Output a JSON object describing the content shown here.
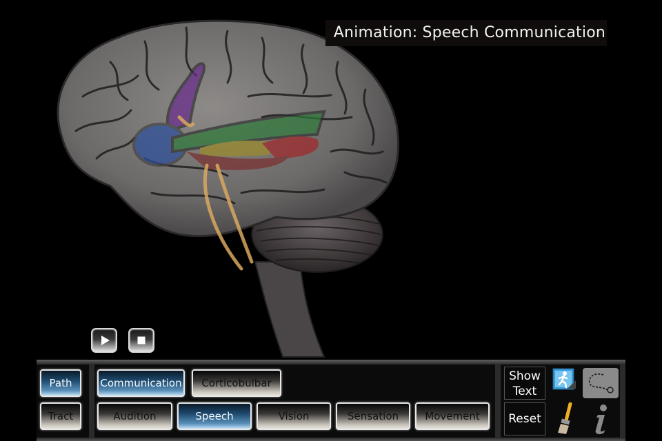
{
  "title": "Animation: Speech Communication",
  "media_controls": {
    "play_icon": "play-icon",
    "stop_icon": "stop-icon"
  },
  "brain_regions": [
    {
      "name": "purple-region",
      "color": "#6a2c8c"
    },
    {
      "name": "blue-region",
      "color": "#2c4f9a"
    },
    {
      "name": "green-region",
      "color": "#2f7a3a"
    },
    {
      "name": "yellow-region",
      "color": "#9a8a2a"
    },
    {
      "name": "red-region",
      "color": "#a0282a"
    },
    {
      "name": "pathway",
      "color": "#d9a860"
    }
  ],
  "panel": {
    "mode_buttons": [
      {
        "label": "Path",
        "active": true
      },
      {
        "label": "Tract",
        "active": false
      }
    ],
    "category_buttons": [
      {
        "label": "Communication",
        "active": true
      },
      {
        "label": "Corticobulbar",
        "active": false
      }
    ],
    "topic_buttons": [
      {
        "label": "Audition",
        "active": false
      },
      {
        "label": "Speech",
        "active": true
      },
      {
        "label": "Vision",
        "active": false
      },
      {
        "label": "Sensation",
        "active": false
      },
      {
        "label": "Movement",
        "active": false
      }
    ],
    "show_text_label_1": "Show",
    "show_text_label_2": "Text",
    "reset_label": "Reset",
    "animation_icon": "running-figure-icon",
    "path_draw_icon": "dashed-path-icon",
    "paint_icon": "paintbrush-icon",
    "info_icon": "info-icon"
  },
  "colors": {
    "active_button": "#4a86b4",
    "inactive_button": "#d8d4cc"
  }
}
